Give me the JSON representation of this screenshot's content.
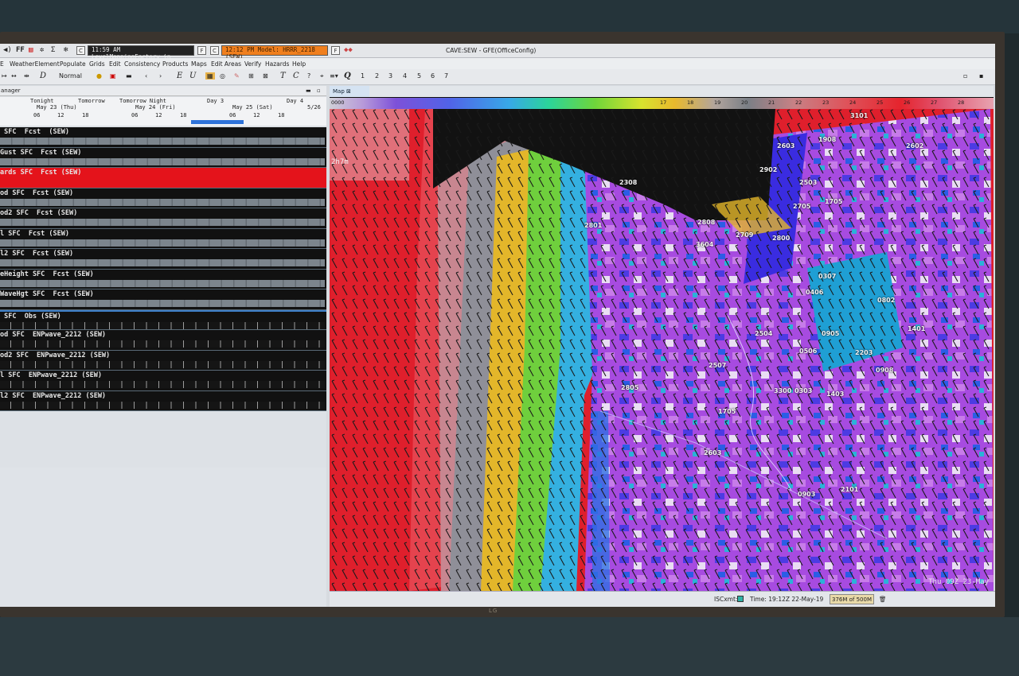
{
  "titlebar": {
    "time_left": "11:59 AM LevelMappingFactory in",
    "model_right": "12:12 PM Model: HRRR_2218 (SEW)",
    "window_title": "CAVE:SEW - GFE(OfficeConfig)",
    "icon_f": "F",
    "icon_c": "C",
    "icon_ff": "FF"
  },
  "menu": [
    "WeatherElement",
    "Populate",
    "Grids",
    "Edit",
    "Consistency",
    "Products",
    "Maps",
    "Edit Areas",
    "Verify",
    "Hazards",
    "Help"
  ],
  "toolbar": {
    "mode": "Normal",
    "e_label": "E",
    "u_label": "U",
    "t_label": "T",
    "c_label": "C",
    "d_label": "D",
    "q_label": "Q",
    "q_numbers": [
      "1",
      "2",
      "3",
      "4",
      "5",
      "6",
      "7"
    ]
  },
  "grid_manager": {
    "header": "anager",
    "timeline": {
      "periods": [
        "Tonight",
        "Tomorrow",
        "Tomorrow Night",
        "Day 3",
        "Day 4"
      ],
      "days": [
        "May 23 (Thu)",
        "May 24 (Fri)",
        "May 25 (Sat)",
        "5/26"
      ],
      "hours": [
        "06",
        "12",
        "18",
        "06",
        "12",
        "18",
        "06",
        "12",
        "18"
      ]
    },
    "rows": [
      {
        "label": " SFC  Fcst  (SEW)",
        "kind": "fcst"
      },
      {
        "label": "Gust SFC  Fcst (SEW)",
        "kind": "fcst"
      },
      {
        "label": "ards SFC  Fcst (SEW)",
        "kind": "red"
      },
      {
        "label": "od SFC  Fcst (SEW)",
        "kind": "fcst"
      },
      {
        "label": "od2 SFC  Fcst (SEW)",
        "kind": "fcst"
      },
      {
        "label": "l SFC  Fcst (SEW)",
        "kind": "fcst"
      },
      {
        "label": "l2 SFC  Fcst (SEW)",
        "kind": "fcst"
      },
      {
        "label": "eHeight SFC  Fcst (SEW)",
        "kind": "fcst"
      },
      {
        "label": "WaveHgt SFC  Fcst (SEW)",
        "kind": "fcst"
      },
      {
        "label": " SFC  Obs (SEW)",
        "kind": "obs"
      },
      {
        "label": "od SFC  ENPwave_2212 (SEW)",
        "kind": "obs"
      },
      {
        "label": "od2 SFC  ENPwave_2212 (SEW)",
        "kind": "obs"
      },
      {
        "label": "l SFC  ENPwave_2212 (SEW)",
        "kind": "obs"
      },
      {
        "label": "l2 SFC  ENPwave_2212 (SEW)",
        "kind": "obs"
      }
    ]
  },
  "map": {
    "tab": "Map",
    "colorbar_start": "0000",
    "colorbar_ticks": [
      "17",
      "18",
      "19",
      "20",
      "21",
      "22",
      "23",
      "24",
      "25",
      "26",
      "27",
      "28"
    ],
    "overlay_label": "2h7m",
    "valid_time": "Thu 09Z 23-May",
    "stations": [
      {
        "id": "3101"
      },
      {
        "id": "1908"
      },
      {
        "id": "2603"
      },
      {
        "id": "2602"
      },
      {
        "id": "2902"
      },
      {
        "id": "2503"
      },
      {
        "id": "2308"
      },
      {
        "id": "2705"
      },
      {
        "id": "1705"
      },
      {
        "id": "2801"
      },
      {
        "id": "2808"
      },
      {
        "id": "2709"
      },
      {
        "id": "2800"
      },
      {
        "id": "3604"
      },
      {
        "id": "0307"
      },
      {
        "id": "0406"
      },
      {
        "id": "0802"
      },
      {
        "id": "2504"
      },
      {
        "id": "0905"
      },
      {
        "id": "1401"
      },
      {
        "id": "0506"
      },
      {
        "id": "2203"
      },
      {
        "id": "2507"
      },
      {
        "id": "0908"
      },
      {
        "id": "2805"
      },
      {
        "id": "3300"
      },
      {
        "id": "0303"
      },
      {
        "id": "1403"
      },
      {
        "id": "1705"
      },
      {
        "id": "2603"
      },
      {
        "id": "0903"
      },
      {
        "id": "2101"
      }
    ]
  },
  "status": {
    "isc": "ISCxmt:",
    "time": "Time: 19:12Z 22-May-19",
    "memory": "376M of 500M"
  }
}
